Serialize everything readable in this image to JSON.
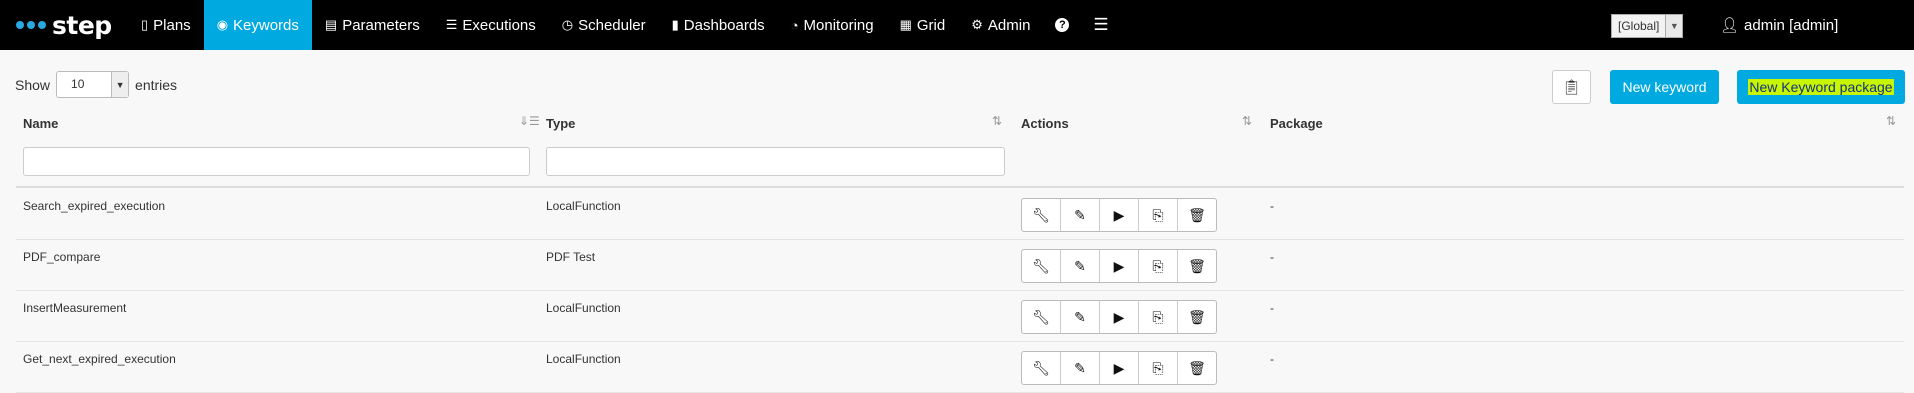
{
  "brand": {
    "name": "step"
  },
  "nav": {
    "items": [
      {
        "icon": "plans-icon",
        "glyph": "▯",
        "label": "Plans",
        "active": false
      },
      {
        "icon": "keywords-icon",
        "glyph": "◉",
        "label": "Keywords",
        "active": true
      },
      {
        "icon": "parameters-icon",
        "glyph": "▤",
        "label": "Parameters",
        "active": false
      },
      {
        "icon": "executions-icon",
        "glyph": "☰",
        "label": "Executions",
        "active": false
      },
      {
        "icon": "scheduler-icon",
        "glyph": "◷",
        "label": "Scheduler",
        "active": false
      },
      {
        "icon": "dashboards-icon",
        "glyph": "▮",
        "label": "Dashboards",
        "active": false
      },
      {
        "icon": "monitoring-icon",
        "glyph": "◔",
        "label": "Monitoring",
        "active": false
      },
      {
        "icon": "grid-icon",
        "glyph": "▦",
        "label": "Grid",
        "active": false
      },
      {
        "icon": "admin-gear-icon",
        "glyph": "⚙",
        "label": "Admin",
        "active": false
      }
    ],
    "help_glyph": "?",
    "menu_glyph": "☰",
    "tenant": "[Global]",
    "user": "admin [admin]"
  },
  "table_controls": {
    "show_label": "Show",
    "page_length": "10",
    "entries_label": "entries"
  },
  "buttons": {
    "new_keyword": "New keyword",
    "new_keyword_package": "New Keyword package"
  },
  "columns": [
    "Name",
    "Type",
    "Actions",
    "Package"
  ],
  "rows": [
    {
      "name": "Search_expired_execution",
      "type": "LocalFunction",
      "package": "-"
    },
    {
      "name": "PDF_compare",
      "type": "PDF Test",
      "package": "-"
    },
    {
      "name": "InsertMeasurement",
      "type": "LocalFunction",
      "package": "-"
    },
    {
      "name": "Get_next_expired_execution",
      "type": "LocalFunction",
      "package": "-"
    }
  ],
  "colors": {
    "navbar": "#000000",
    "accent": "#00a9e0",
    "highlight": "#c8f500"
  }
}
